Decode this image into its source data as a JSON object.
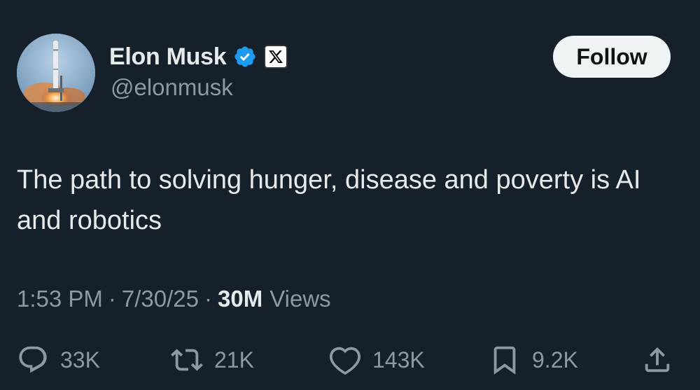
{
  "author": {
    "display_name": "Elon Musk",
    "handle": "@elonmusk",
    "avatar_icon": "rocket-launch-avatar",
    "verified_icon": "verified-badge-icon",
    "affiliate_icon": "x-logo-icon"
  },
  "follow_button": {
    "label": "Follow"
  },
  "tweet": {
    "text": "The path to solving hunger, disease and poverty is AI and robotics"
  },
  "meta": {
    "time": "1:53 PM",
    "separator": "·",
    "date": "7/30/25",
    "views_count": "30M",
    "views_label": "Views"
  },
  "actions": {
    "replies": "33K",
    "reposts": "21K",
    "likes": "143K",
    "bookmarks": "9.2K"
  },
  "colors": {
    "background": "#15202b",
    "text_primary": "#e7e9ea",
    "text_secondary": "#8b98a5",
    "verified_blue": "#1d9bf0",
    "button_bg": "#eff3f4"
  }
}
